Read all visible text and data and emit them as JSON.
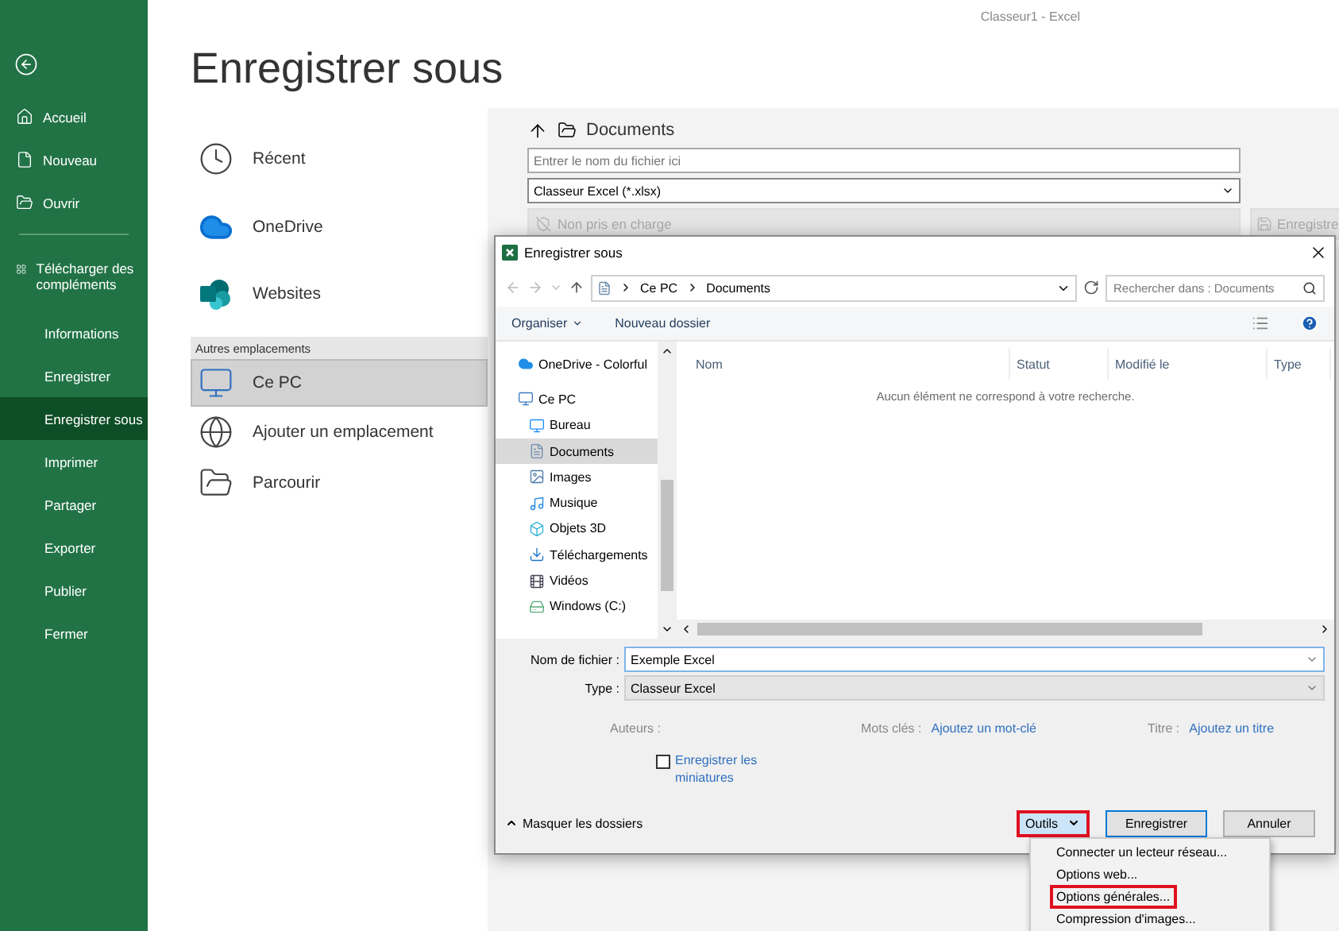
{
  "window": {
    "title": "Classeur1  -  Excel"
  },
  "backstage_nav": {
    "items": [
      {
        "label": "Accueil",
        "kind": "home",
        "selected": false
      },
      {
        "label": "Nouveau",
        "kind": "new",
        "selected": false
      },
      {
        "label": "Ouvrir",
        "kind": "open",
        "selected": false
      },
      {
        "label": "Télécharger des compléments",
        "kind": "addins",
        "selected": false
      },
      {
        "label": "Informations",
        "kind": "plain",
        "selected": false
      },
      {
        "label": "Enregistrer",
        "kind": "plain",
        "selected": false
      },
      {
        "label": "Enregistrer sous",
        "kind": "plain",
        "selected": true
      },
      {
        "label": "Imprimer",
        "kind": "plain",
        "selected": false
      },
      {
        "label": "Partager",
        "kind": "plain",
        "selected": false
      },
      {
        "label": "Exporter",
        "kind": "plain",
        "selected": false
      },
      {
        "label": "Publier",
        "kind": "plain",
        "selected": false
      },
      {
        "label": "Fermer",
        "kind": "plain",
        "selected": false
      }
    ]
  },
  "page_title": "Enregistrer sous",
  "locations": {
    "items": [
      {
        "label": "Récent",
        "kind": "recent",
        "selected": false
      },
      {
        "label": "OneDrive",
        "kind": "onedrive",
        "selected": false
      },
      {
        "label": "Websites",
        "kind": "sharepoint",
        "selected": false
      }
    ],
    "section_title": "Autres emplacements",
    "other_items": [
      {
        "label": "Ce PC",
        "kind": "pc",
        "selected": true
      },
      {
        "label": "Ajouter un emplacement",
        "kind": "add",
        "selected": false
      },
      {
        "label": "Parcourir",
        "kind": "browse",
        "selected": false
      }
    ]
  },
  "save_panel": {
    "folder": "Documents",
    "filename_placeholder": "Entrer le nom du fichier ici",
    "file_type": "Classeur Excel (*.xlsx)",
    "sensitivity": "Non pris en charge",
    "save_button": "Enregistre"
  },
  "dialog": {
    "title": "Enregistrer sous",
    "breadcrumb": [
      "Ce PC",
      "Documents"
    ],
    "search_placeholder": "Rechercher dans : Documents",
    "toolbar": [
      {
        "label": "Organiser",
        "kind": "menu"
      },
      {
        "label": "Nouveau dossier",
        "kind": "plain"
      }
    ],
    "nav_tree": [
      {
        "label": "OneDrive - Colorful",
        "kind": "onedrive",
        "selected": false
      },
      {
        "label": "Ce PC",
        "kind": "pc",
        "selected": false,
        "children": [
          {
            "label": "Bureau",
            "kind": "desktop",
            "selected": false
          },
          {
            "label": "Documents",
            "kind": "documents",
            "selected": true
          },
          {
            "label": "Images",
            "kind": "images",
            "selected": false
          },
          {
            "label": "Musique",
            "kind": "music",
            "selected": false
          },
          {
            "label": "Objets 3D",
            "kind": "objects3d",
            "selected": false
          },
          {
            "label": "Téléchargements",
            "kind": "downloads",
            "selected": false
          },
          {
            "label": "Vidéos",
            "kind": "videos",
            "selected": false
          },
          {
            "label": "Windows (C:)",
            "kind": "drive",
            "selected": false
          }
        ]
      }
    ],
    "columns": [
      "Nom",
      "Statut",
      "Modifié le",
      "Type"
    ],
    "empty_message": "Aucun élément ne correspond à votre recherche.",
    "filename_label": "Nom de fichier :",
    "filename": "Exemple Excel",
    "type_label": "Type :",
    "type": "Classeur Excel",
    "metadata": [
      {
        "label": "Auteurs :"
      },
      {
        "label": "Mots clés :",
        "link": "Ajoutez un mot-clé"
      },
      {
        "label": "Titre :",
        "link": "Ajoutez un titre"
      }
    ],
    "thumbnail_checkbox": {
      "label": "Enregistrer les miniatures",
      "checked": false
    },
    "hide_folders": "Masquer les dossiers",
    "tools_button": {
      "label": "Outils",
      "highlighted": true
    },
    "save_button": "Enregistrer",
    "cancel_button": "Annuler"
  },
  "tools_menu": {
    "items": [
      {
        "label": "Connecter un lecteur réseau...",
        "highlighted": false
      },
      {
        "label": "Options web...",
        "highlighted": false
      },
      {
        "label": "Options générales...",
        "highlighted": true
      },
      {
        "label": "Compression d'images...",
        "highlighted": false
      }
    ]
  }
}
